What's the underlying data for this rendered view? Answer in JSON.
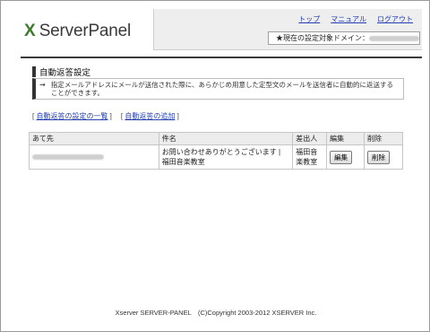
{
  "brand": {
    "mark": "X",
    "name": "ServerPanel"
  },
  "top_nav": [
    "トップ",
    "マニュアル",
    "ログアウト"
  ],
  "domain_box": {
    "label": "★現在の設定対象ドメイン："
  },
  "section": {
    "title": "自動返答設定",
    "desc_arrow": "→",
    "description": "指定メールアドレスにメールが送信された際に、あらかじめ用意した定型文のメールを送信者に自動的に返送することができます。"
  },
  "links": [
    {
      "label": "自動返答の設定の一覧"
    },
    {
      "label": "自動返答の追加"
    }
  ],
  "table": {
    "headers": [
      "あて先",
      "件名",
      "差出人",
      "編集",
      "削除"
    ],
    "rows": [
      {
        "subject": "お問い合わせありがとうございます | 福田音楽教室",
        "sender": "福田音楽教室",
        "edit": "編集",
        "delete": "削除"
      }
    ]
  },
  "footer": "Xserver SERVER-PANEL　(C)Copyright 2003-2012 XSERVER Inc.",
  "colors": {
    "brand_green": "#3d7a2b",
    "link_blue": "#2440b4"
  }
}
